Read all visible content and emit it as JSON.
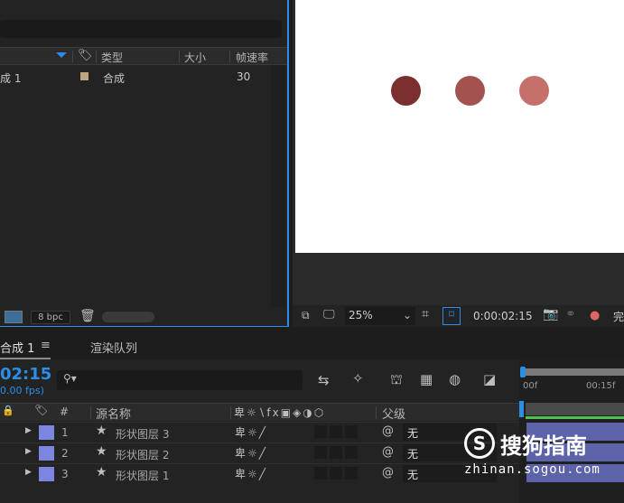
{
  "project": {
    "columns": {
      "type": "类型",
      "size": "大小",
      "fps": "帧速率"
    },
    "row": {
      "name": "成 1",
      "type": "合成",
      "fps": "30"
    },
    "footer": {
      "bpc": "8 bpc"
    }
  },
  "viewer": {
    "zoom": "25%",
    "timecode": "0:00:02:15",
    "dots": [
      {
        "color": "#7a2e2e"
      },
      {
        "color": "#a2524f"
      },
      {
        "color": "#c5706a"
      }
    ],
    "cut_label": "完"
  },
  "tabs": {
    "comp": "合成 1",
    "render": "渲染队列"
  },
  "timeline": {
    "time": "02:15",
    "fps": "0.00 fps)",
    "ruler": {
      "start": "00f",
      "mid": "00:15f"
    },
    "columns": {
      "num": "#",
      "source": "源名称",
      "parent": "父级"
    },
    "layers": [
      {
        "num": "1",
        "name": "形状图层 3",
        "parent": "无"
      },
      {
        "num": "2",
        "name": "形状图层 2",
        "parent": "无"
      },
      {
        "num": "3",
        "name": "形状图层 1",
        "parent": "无"
      }
    ]
  },
  "watermark": {
    "brand": "搜狗指南",
    "url": "zhinan.sogou.com"
  },
  "colors": {
    "accent": "#2d8ceb",
    "label": "#7c85e0",
    "time": "#2b8fe6"
  }
}
